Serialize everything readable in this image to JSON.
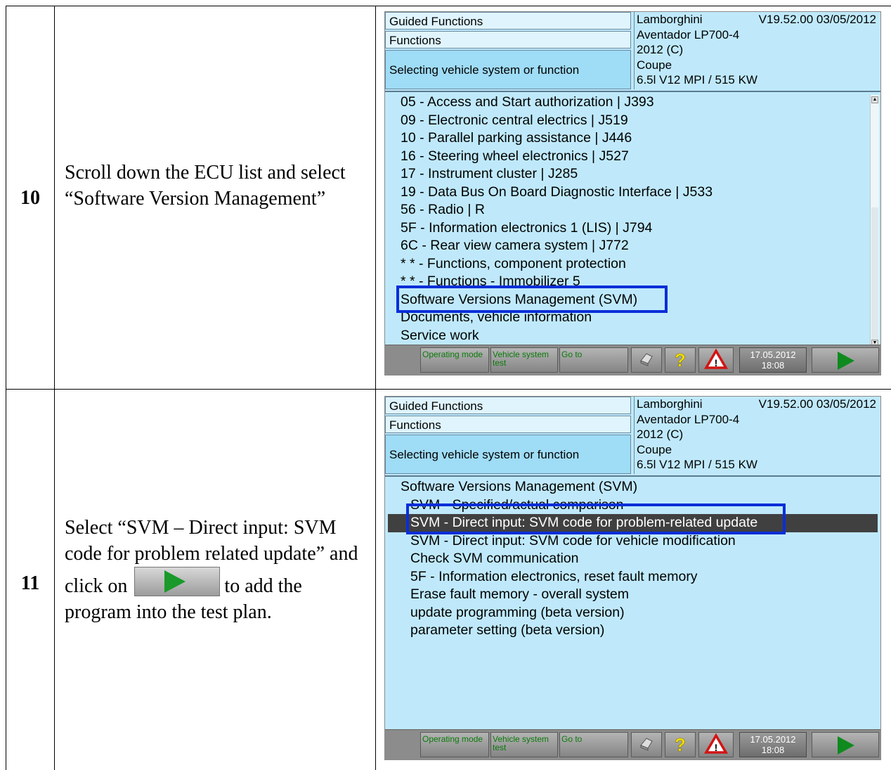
{
  "steps": [
    {
      "number": "10",
      "instruction": "Scroll down the ECU list and select “Software Version Management”"
    },
    {
      "number": "11",
      "instruction_before": "Select “SVM – Direct input: SVM code for problem related update” and click on",
      "instruction_after": "to add the program into the test plan."
    }
  ],
  "screen": {
    "nav": [
      "Guided Functions",
      "Functions",
      "Selecting vehicle system or function"
    ],
    "vehicle": {
      "brand": "Lamborghini",
      "version": "V19.52.00 03/05/2012",
      "model": "Aventador LP700-4",
      "year": "2012 (C)",
      "body": "Coupe",
      "engine": "6.5l V12 MPI / 515 KW"
    },
    "toolbar": {
      "operating_mode": "Operating mode",
      "vehicle_system_test": "Vehicle system test",
      "go_to": "Go to",
      "date": "17.05.2012",
      "time": "18:08"
    },
    "icons": [
      "printer-icon",
      "help-icon",
      "warning-icon",
      "next-arrow-icon"
    ],
    "highlight_color": "#0a2ed8",
    "selected_row_color": "#404040"
  },
  "ecu_list": [
    "05 - Access and Start authorization | J393",
    "09 - Electronic central electrics | J519",
    "10 - Parallel parking assistance | J446",
    "16 - Steering wheel electronics | J527",
    "17 - Instrument cluster | J285",
    "19 - Data Bus On Board Diagnostic Interface | J533",
    "56 - Radio | R",
    "5F - Information electronics 1 (LIS) | J794",
    "6C - Rear view camera system | J772",
    "* * - Functions, component protection",
    "* * - Functions - Immobilizer 5",
    "Software Versions Management (SVM)",
    "Documents, vehicle information",
    "Service work"
  ],
  "svm_list": {
    "title": "Software Versions Management (SVM)",
    "items": [
      "SVM - Specified/actual comparison",
      "SVM - Direct input: SVM code for problem-related update",
      "SVM - Direct input: SVM code for vehicle modification",
      "Check SVM communication",
      "5F - Information electronics, reset fault memory",
      "Erase fault memory - overall system",
      "update programming (beta version)",
      "parameter setting (beta version)"
    ]
  }
}
